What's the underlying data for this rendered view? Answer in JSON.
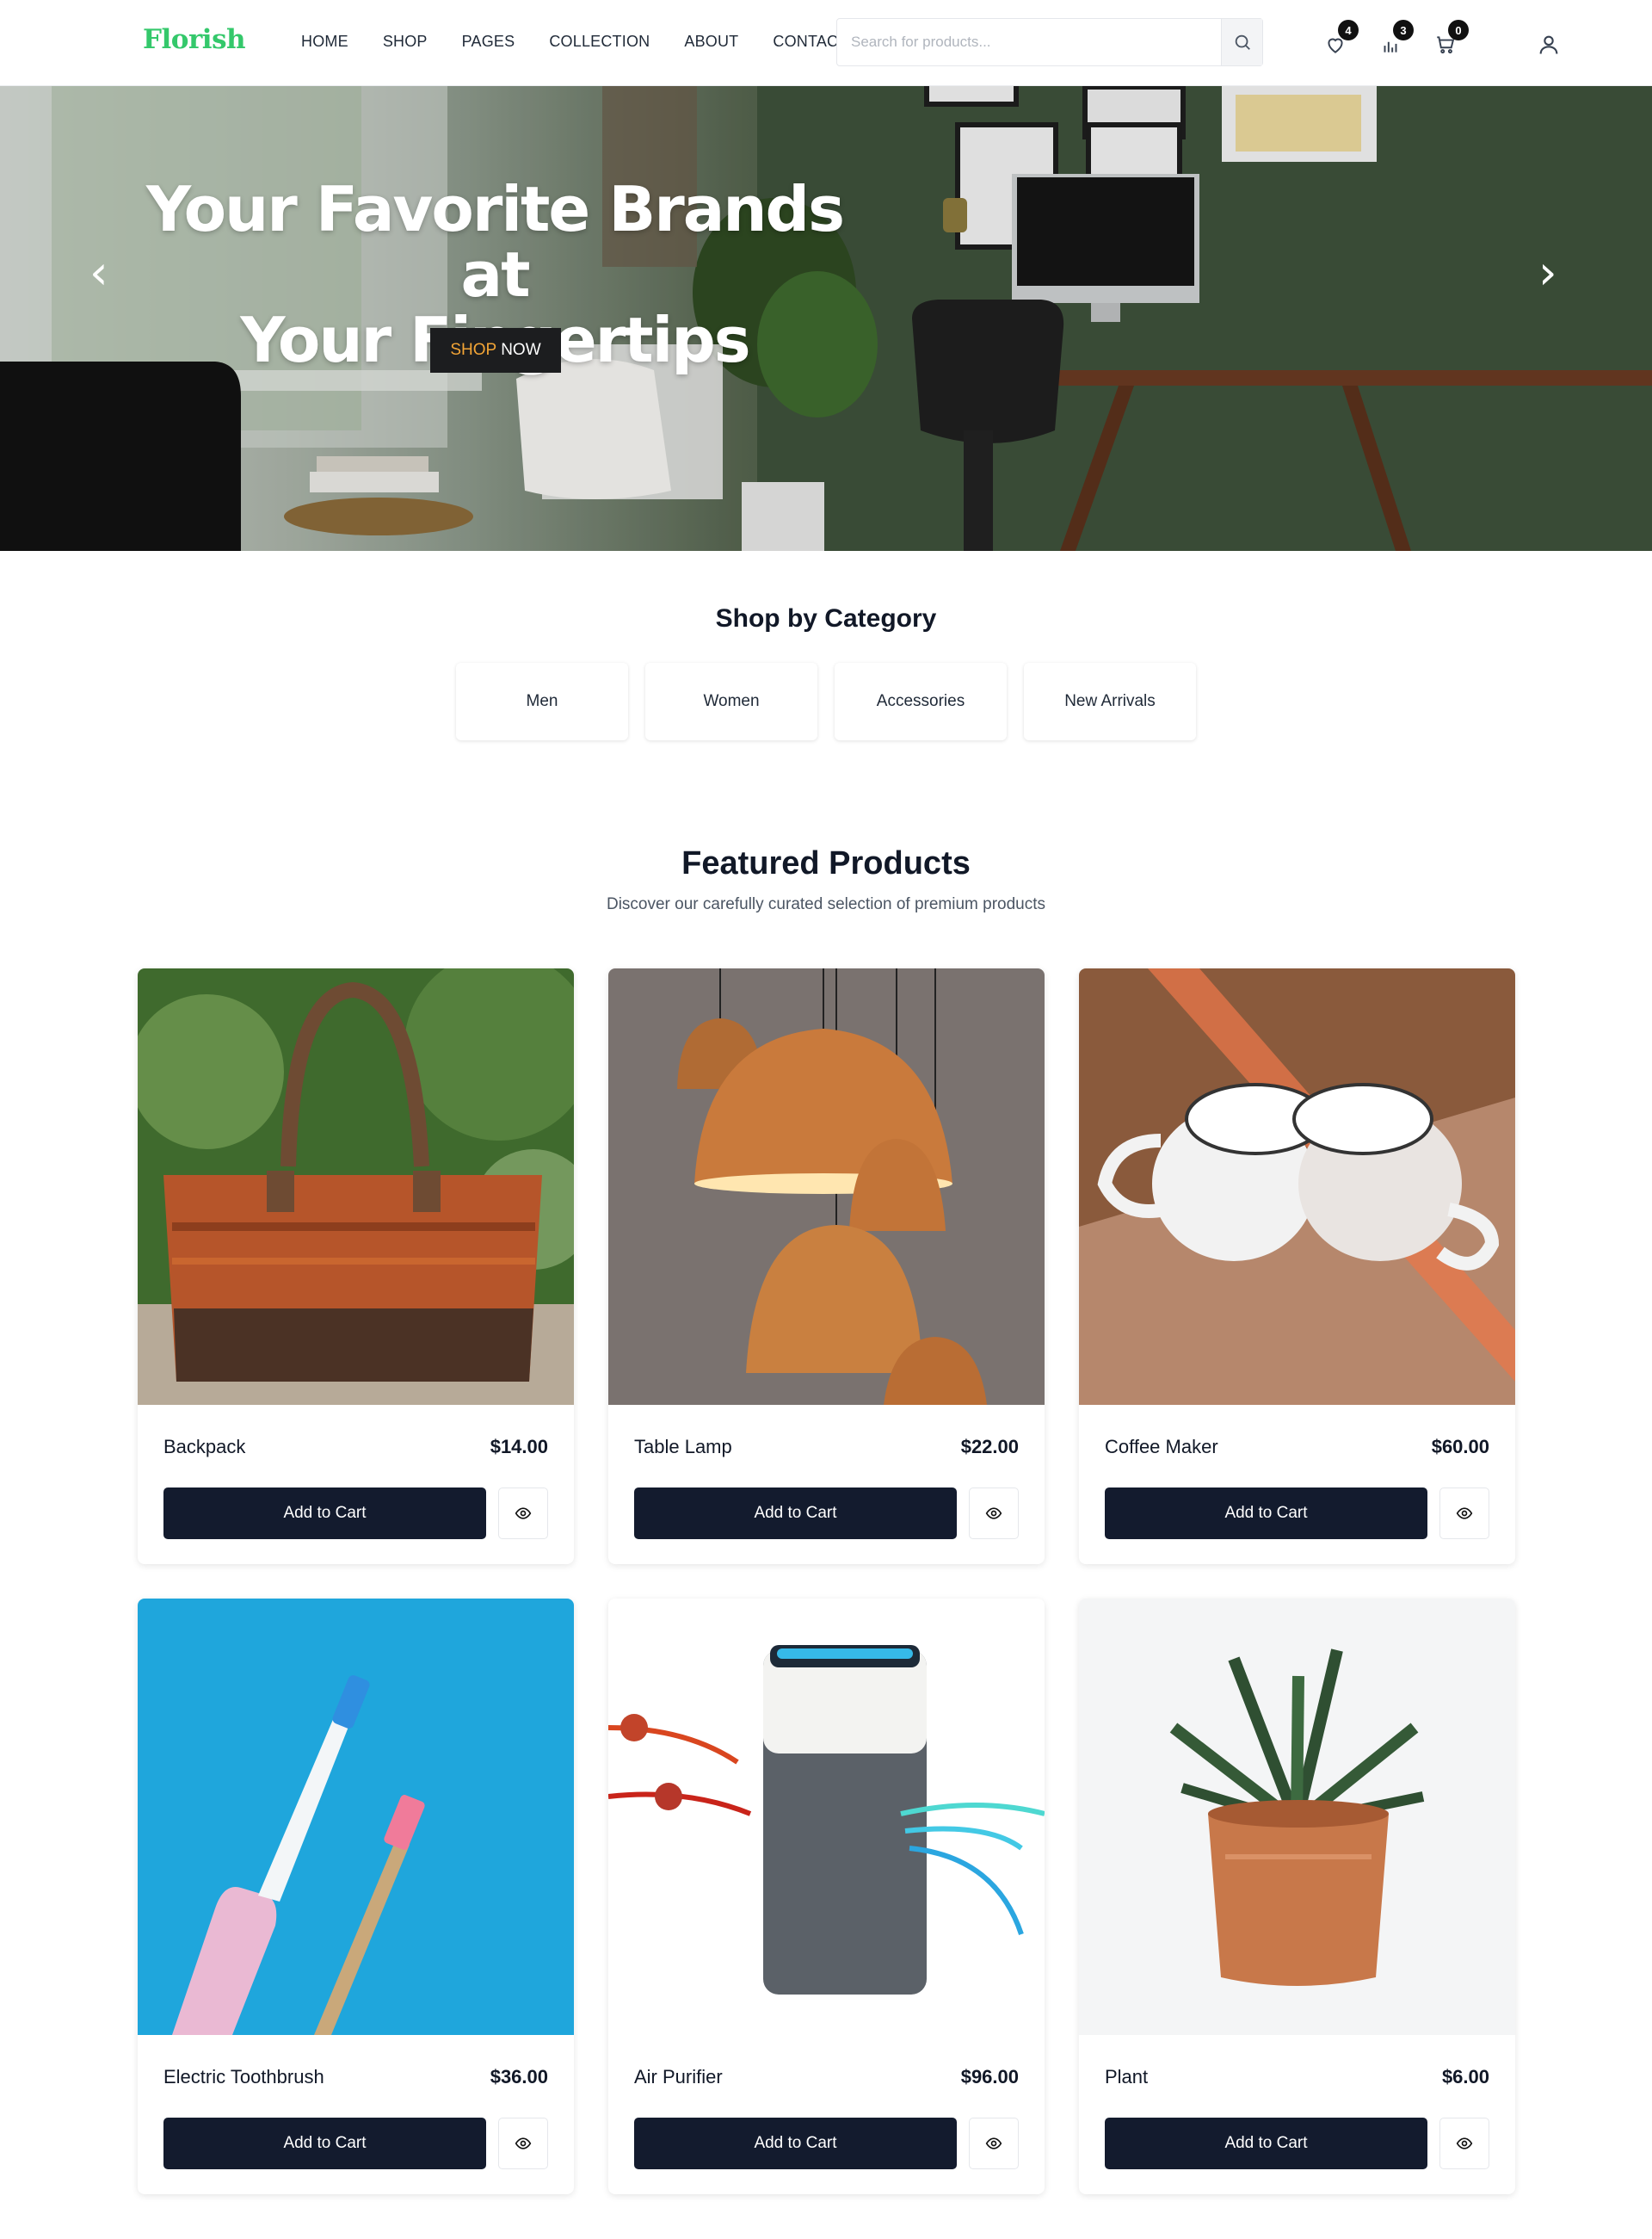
{
  "brand": {
    "logo": "Florish",
    "accent_color": "#34c86b"
  },
  "nav": {
    "items": [
      "HOME",
      "SHOP",
      "PAGES",
      "COLLECTION",
      "ABOUT",
      "CONTACT"
    ]
  },
  "search": {
    "placeholder": "Search for products...",
    "value": ""
  },
  "header_icons": {
    "wishlist": {
      "icon": "heart-icon",
      "count": "4"
    },
    "compare": {
      "icon": "bar-chart-icon",
      "count": "3"
    },
    "cart": {
      "icon": "cart-icon",
      "count": "0"
    },
    "account": {
      "icon": "user-icon"
    }
  },
  "hero": {
    "title_line1": "Your Favorite Brands at",
    "title_line2": "Your Fingertips",
    "cta_accent": "SHOP",
    "cta_rest": "NOW",
    "cta_accent_color": "#f3a536",
    "prev_glyph": "‹",
    "next_glyph": "›"
  },
  "categories": {
    "title": "Shop by Category",
    "items": [
      "Men",
      "Women",
      "Accessories",
      "New Arrivals"
    ]
  },
  "featured": {
    "title": "Featured Products",
    "subtitle": "Discover our carefully curated selection of premium products",
    "add_to_cart_label": "Add to Cart",
    "products": [
      {
        "name": "Backpack",
        "price": "$14.00",
        "image": "woven-basket-bag"
      },
      {
        "name": "Table Lamp",
        "price": "$22.00",
        "image": "copper-pendant-lamps"
      },
      {
        "name": "Coffee Maker",
        "price": "$60.00",
        "image": "white-enamel-mugs"
      },
      {
        "name": "Electric Toothbrush",
        "price": "$36.00",
        "image": "toothbrushes-on-blue"
      },
      {
        "name": "Air Purifier",
        "price": "$96.00",
        "image": "air-purifier-unit"
      },
      {
        "name": "Plant",
        "price": "$6.00",
        "image": "succulent-copper-pot"
      }
    ]
  }
}
